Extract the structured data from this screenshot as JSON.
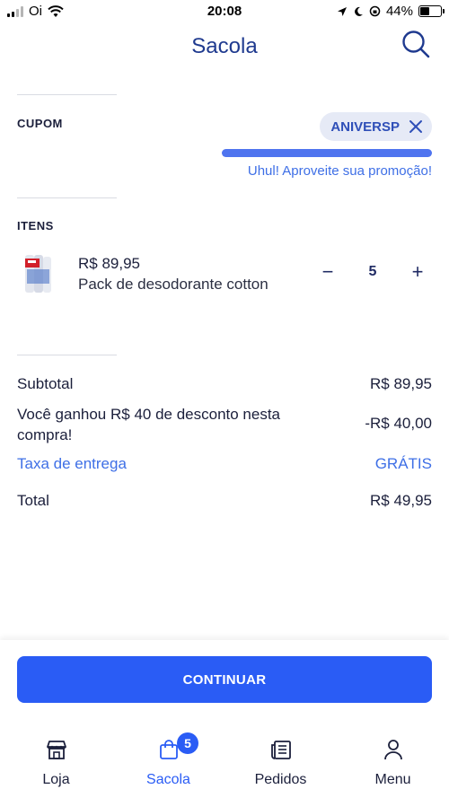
{
  "status_bar": {
    "carrier": "Oi",
    "time": "20:08",
    "battery": "44%",
    "battery_level": 0.44
  },
  "header": {
    "title": "Sacola",
    "search_icon": "search-icon"
  },
  "coupon": {
    "label": "CUPOM",
    "code": "ANIVERSP",
    "message": "Uhul! Aproveite sua promoção!",
    "remove_icon": "close-icon"
  },
  "items_section": {
    "label": "ITENS",
    "items": [
      {
        "price": "R$ 89,95",
        "name": "Pack de desodorante cotton",
        "quantity": "5",
        "minus_label": "−",
        "plus_label": "+"
      }
    ]
  },
  "summary": {
    "subtotal_label": "Subtotal",
    "subtotal_value": "R$ 89,95",
    "discount_label": "Você ganhou R$ 40 de desconto nesta compra!",
    "discount_value": "-R$ 40,00",
    "delivery_label": "Taxa de entrega",
    "delivery_value": "GRÁTIS",
    "total_label": "Total",
    "total_value": "R$ 49,95"
  },
  "actions": {
    "continue_label": "CONTINUAR"
  },
  "tab_bar": {
    "tabs": [
      {
        "label": "Loja",
        "icon": "store-icon"
      },
      {
        "label": "Sacola",
        "icon": "bag-icon",
        "badge": "5",
        "active": true
      },
      {
        "label": "Pedidos",
        "icon": "orders-icon"
      },
      {
        "label": "Menu",
        "icon": "user-icon"
      }
    ]
  },
  "colors": {
    "accent": "#2a5cf5",
    "title": "#1f3a8f",
    "link": "#3e6fe6"
  }
}
